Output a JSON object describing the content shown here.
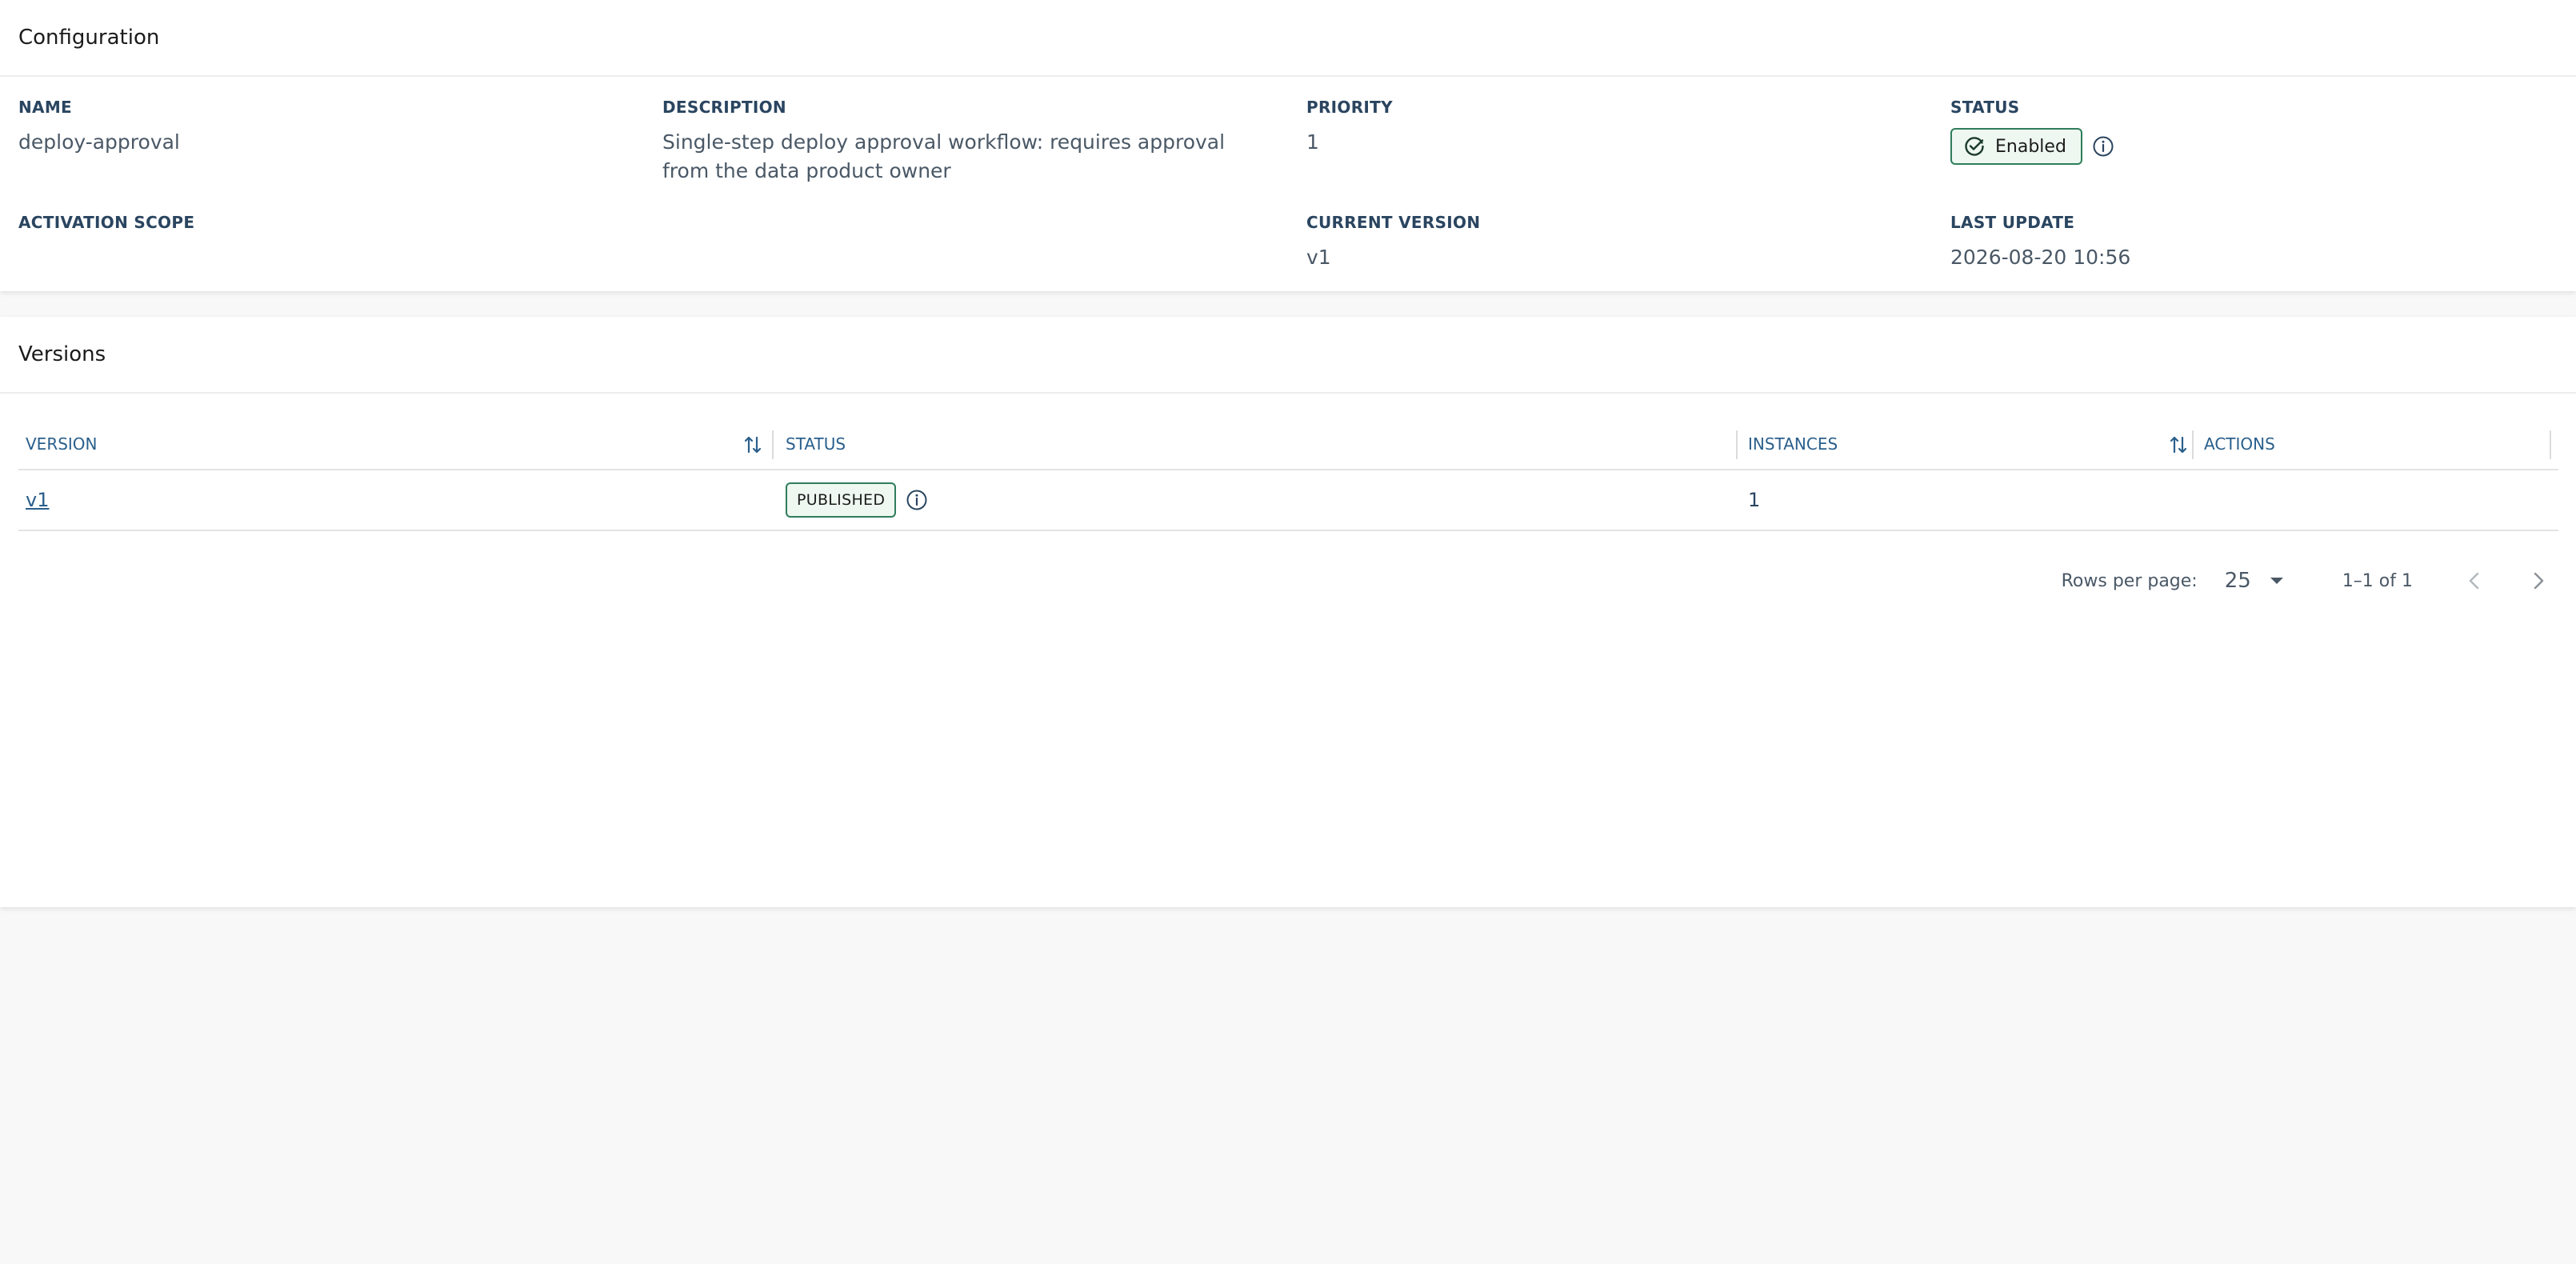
{
  "configuration": {
    "title": "Configuration",
    "fields": {
      "name": {
        "label": "NAME",
        "value": "deploy-approval"
      },
      "description": {
        "label": "DESCRIPTION",
        "value": "Single-step deploy approval workflow: requires approval from the data product owner"
      },
      "priority": {
        "label": "PRIORITY",
        "value": "1"
      },
      "status": {
        "label": "STATUS",
        "value": "Enabled"
      },
      "activation_scope": {
        "label": "ACTIVATION SCOPE",
        "value": ""
      },
      "current_version": {
        "label": "CURRENT VERSION",
        "value": "v1"
      },
      "last_update": {
        "label": "LAST UPDATE",
        "value": "2026-08-20 10:56"
      }
    }
  },
  "versions": {
    "title": "Versions",
    "columns": {
      "version": "VERSION",
      "status": "STATUS",
      "instances": "INSTANCES",
      "actions": "ACTIONS"
    },
    "rows": [
      {
        "version": "v1",
        "status": "PUBLISHED",
        "instances": "1"
      }
    ],
    "pagination": {
      "rows_per_page_label": "Rows per page:",
      "rows_per_page": "25",
      "range": "1–1 of 1"
    }
  },
  "colors": {
    "accent": "#2a5f8c",
    "success_border": "#2e7d5b",
    "success_bg": "#eef8f1",
    "page_bg": "#f8f8f8"
  },
  "icons": {
    "status": "check-circle-icon",
    "info": "info-icon",
    "sort": "sort-arrows-icon",
    "dropdown": "caret-down-icon",
    "prev": "chevron-left-icon",
    "next": "chevron-right-icon"
  }
}
